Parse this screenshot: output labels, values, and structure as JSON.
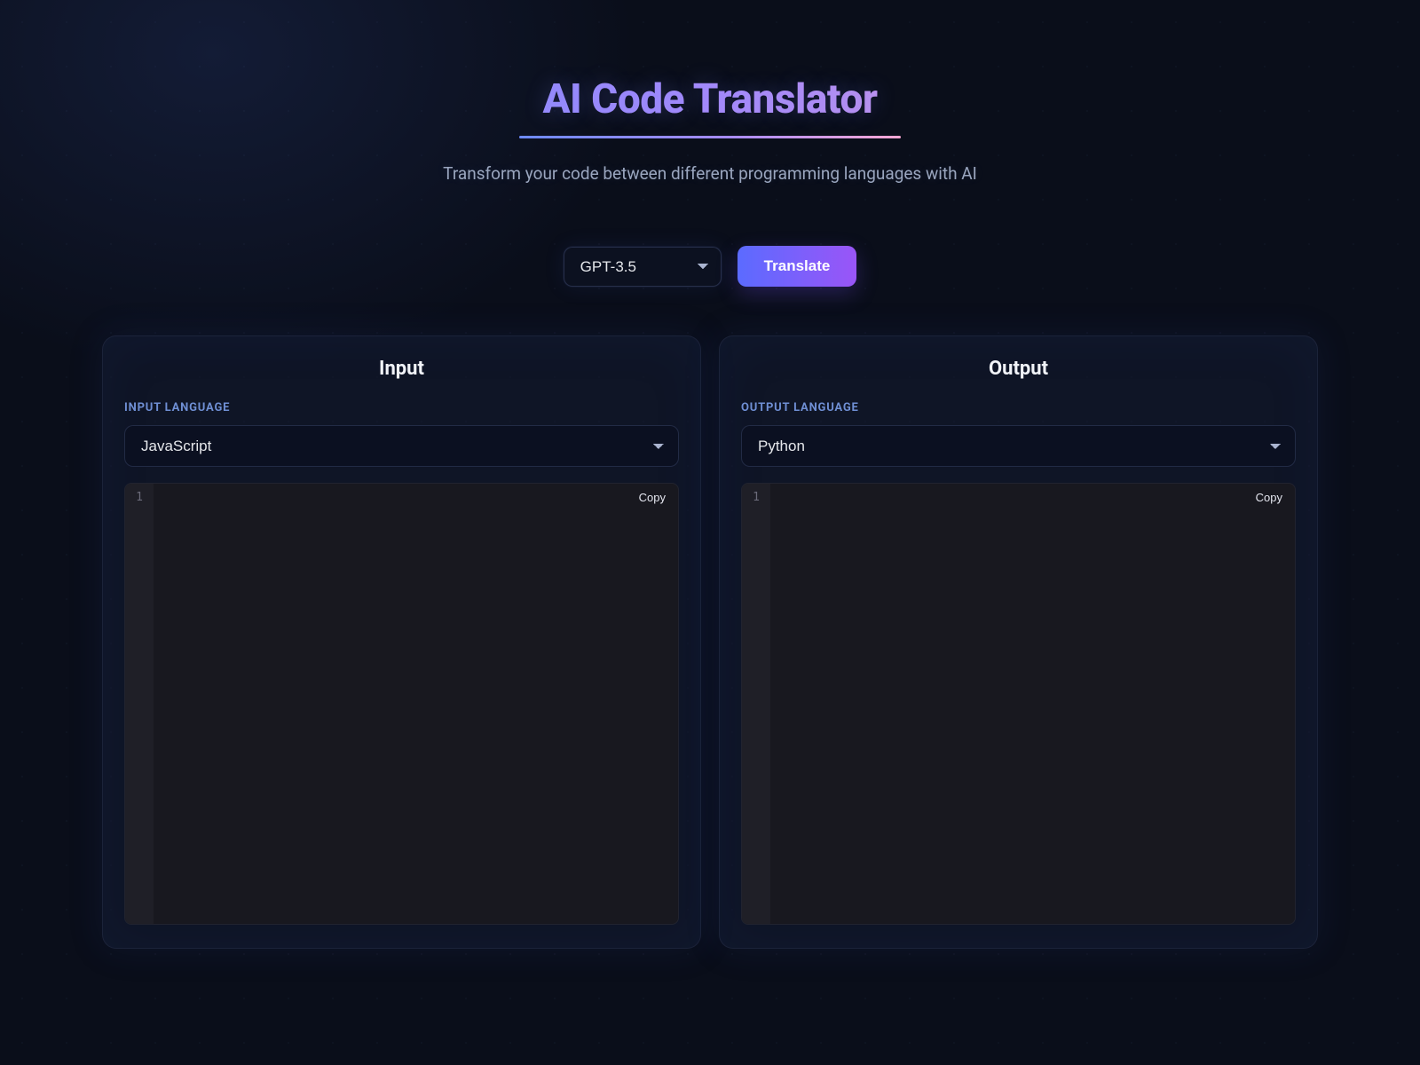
{
  "header": {
    "title": "AI Code Translator",
    "subtitle": "Transform your code between different programming languages with AI"
  },
  "controls": {
    "model_selected": "GPT-3.5",
    "translate_label": "Translate"
  },
  "input_panel": {
    "title": "Input",
    "lang_label": "INPUT LANGUAGE",
    "lang_selected": "JavaScript",
    "line_number": "1",
    "copy_label": "Copy",
    "code": ""
  },
  "output_panel": {
    "title": "Output",
    "lang_label": "OUTPUT LANGUAGE",
    "lang_selected": "Python",
    "line_number": "1",
    "copy_label": "Copy",
    "code": ""
  }
}
